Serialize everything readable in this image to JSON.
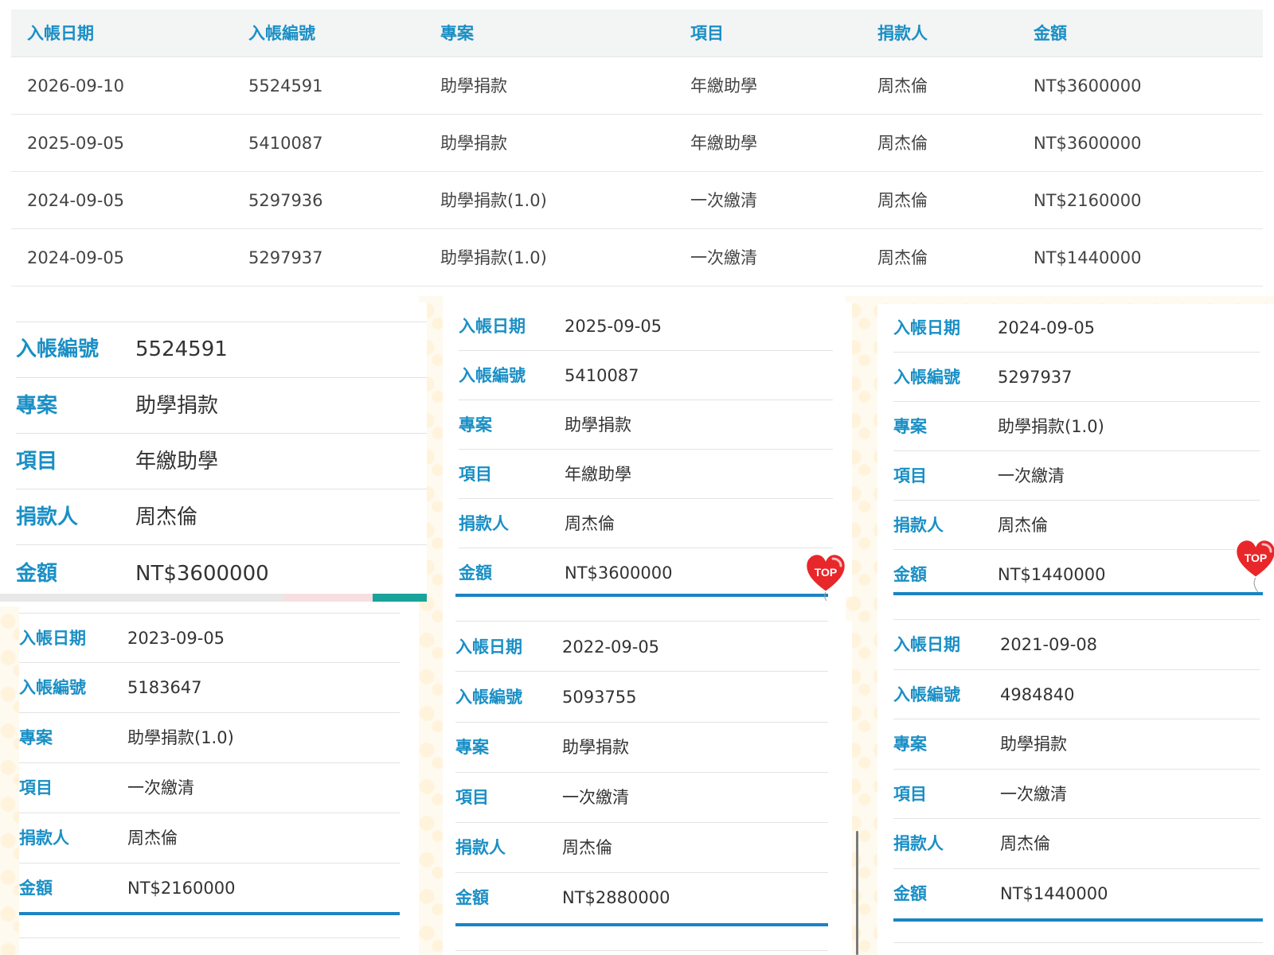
{
  "table": {
    "headers": [
      "入帳日期",
      "入帳編號",
      "專案",
      "項目",
      "捐款人",
      "金額"
    ],
    "rows": [
      [
        "2026-09-10",
        "5524591",
        "助學捐款",
        "年繳助學",
        "周杰倫",
        "NT$3600000"
      ],
      [
        "2025-09-05",
        "5410087",
        "助學捐款",
        "年繳助學",
        "周杰倫",
        "NT$3600000"
      ],
      [
        "2024-09-05",
        "5297936",
        "助學捐款(1.0)",
        "一次繳清",
        "周杰倫",
        "NT$2160000"
      ],
      [
        "2024-09-05",
        "5297937",
        "助學捐款(1.0)",
        "一次繳清",
        "周杰倫",
        "NT$1440000"
      ]
    ]
  },
  "labels": {
    "date": "入帳日期",
    "number": "入帳編號",
    "project": "專案",
    "item": "項目",
    "donor": "捐款人",
    "amount": "金額"
  },
  "cards": [
    {
      "number": "5524591",
      "project": "助學捐款",
      "item": "年繳助學",
      "donor": "周杰倫",
      "amount": "NT$3600000"
    },
    {
      "date": "2025-09-05",
      "number": "5410087",
      "project": "助學捐款",
      "item": "年繳助學",
      "donor": "周杰倫",
      "amount": "NT$3600000"
    },
    {
      "date": "2024-09-05",
      "number": "5297937",
      "project": "助學捐款(1.0)",
      "item": "一次繳清",
      "donor": "周杰倫",
      "amount": "NT$1440000"
    },
    {
      "date": "2023-09-05",
      "number": "5183647",
      "project": "助學捐款(1.0)",
      "item": "一次繳清",
      "donor": "周杰倫",
      "amount": "NT$2160000"
    },
    {
      "date": "2022-09-05",
      "number": "5093755",
      "project": "助學捐款",
      "item": "一次繳清",
      "donor": "周杰倫",
      "amount": "NT$2880000"
    },
    {
      "date": "2021-09-08",
      "number": "4984840",
      "project": "助學捐款",
      "item": "一次繳清",
      "donor": "周杰倫",
      "amount": "NT$1440000"
    }
  ],
  "top_button": {
    "label": "TOP",
    "icon": "heart-balloon-icon"
  },
  "colors": {
    "accent": "#1a8fc5",
    "underline": "#1a84c4",
    "top_red": "#e8272b"
  }
}
